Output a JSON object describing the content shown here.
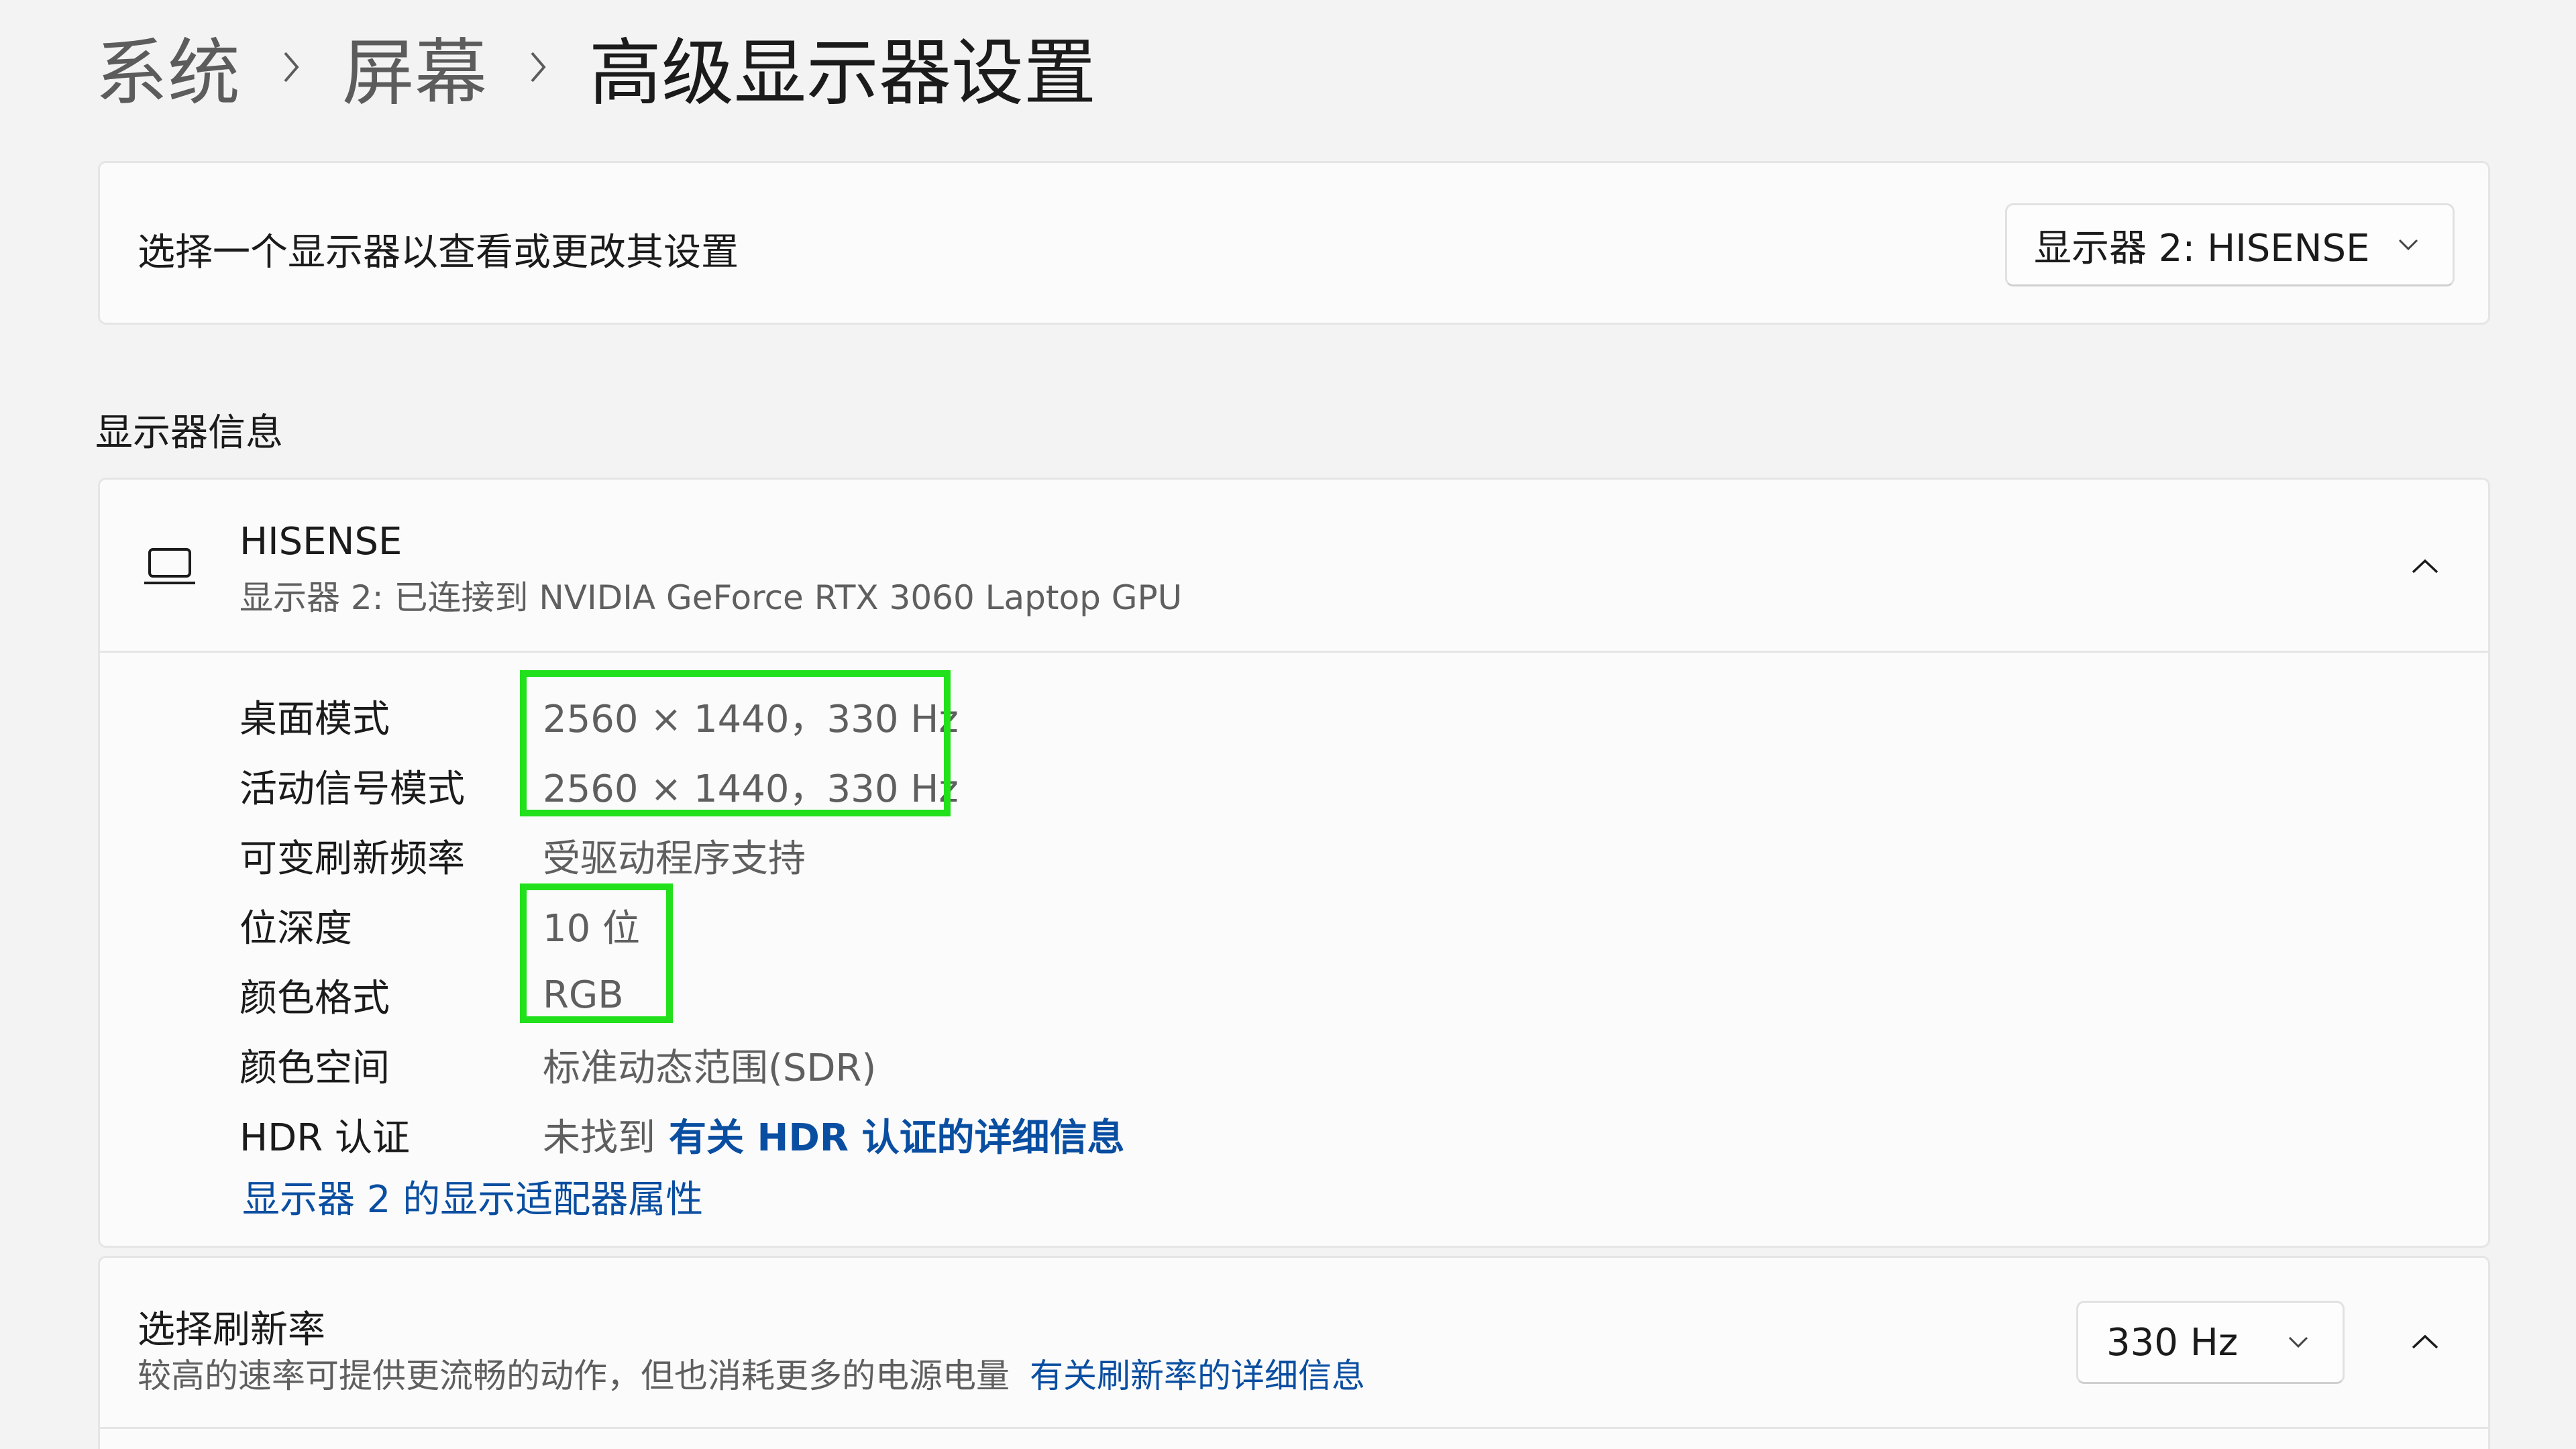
{
  "breadcrumb": {
    "items": [
      "系统",
      "屏幕",
      "高级显示器设置"
    ]
  },
  "monitor_select": {
    "prompt": "选择一个显示器以查看或更改其设置",
    "selected": "显示器 2: HISENSE"
  },
  "display_info": {
    "section_title": "显示器信息",
    "name": "HISENSE",
    "subtitle": "显示器 2: 已连接到 NVIDIA GeForce RTX 3060 Laptop GPU",
    "rows": [
      {
        "label": "桌面模式",
        "value": "2560 × 1440，330 Hz"
      },
      {
        "label": "活动信号模式",
        "value": "2560 × 1440，330 Hz"
      },
      {
        "label": "可变刷新频率",
        "value": "受驱动程序支持"
      },
      {
        "label": "位深度",
        "value": "10 位"
      },
      {
        "label": "颜色格式",
        "value": "RGB"
      },
      {
        "label": "颜色空间",
        "value": "标准动态范围(SDR)"
      },
      {
        "label": "HDR 认证",
        "value": "未找到",
        "link": "有关 HDR 认证的详细信息"
      }
    ],
    "adapter_link": "显示器 2 的显示适配器属性"
  },
  "refresh_rate": {
    "title": "选择刷新率",
    "description": "较高的速率可提供更流畅的动作，但也消耗更多的电源电量",
    "link": "有关刷新率的详细信息",
    "selected": "330 Hz"
  },
  "colors": {
    "background": "#f3f3f3",
    "card": "#fbfbfb",
    "link": "#0a4ea1",
    "highlight": "#22e01c"
  },
  "icons": {
    "separator": "chevron-right-icon",
    "dropdown": "chevron-down-icon",
    "collapse": "chevron-up-icon",
    "display": "laptop-icon"
  }
}
